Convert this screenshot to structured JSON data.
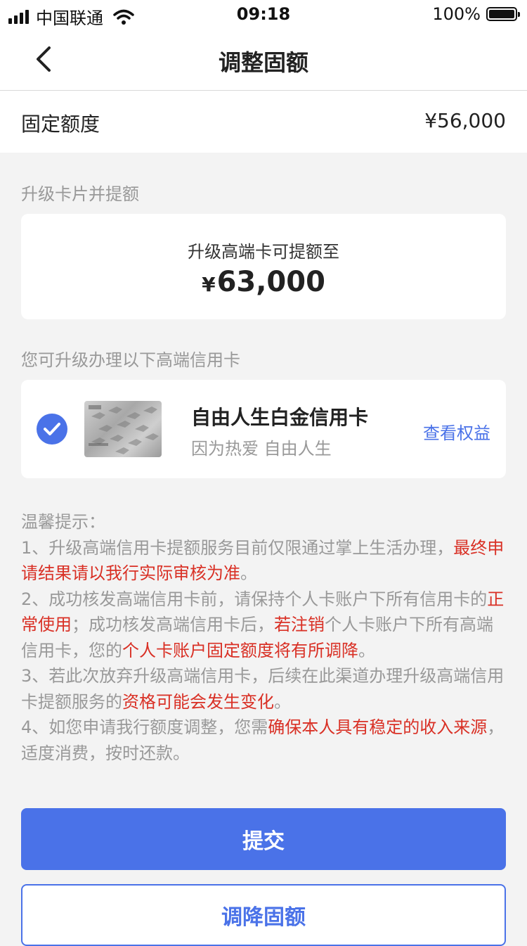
{
  "status_bar": {
    "carrier": "中国联通",
    "time": "09:18",
    "battery": "100%",
    "signal_icon": "signal-bars-icon",
    "wifi_icon": "wifi-icon",
    "battery_icon": "battery-icon"
  },
  "nav": {
    "title": "调整固额",
    "back_icon": "chevron-left-icon"
  },
  "fixed_limit": {
    "label": "固定额度",
    "value": "¥56,000"
  },
  "upgrade_section": {
    "label": "升级卡片并提额",
    "card_subtitle": "升级高端卡可提额至",
    "amount_symbol": "¥",
    "amount_value": "63,000"
  },
  "options_section": {
    "label": "您可升级办理以下高端信用卡",
    "card": {
      "name": "自由人生白金信用卡",
      "slogan": "因为热爱 自由人生",
      "link": "查看权益",
      "selected": true,
      "check_icon": "check-circle-icon"
    }
  },
  "tips": {
    "title": "温馨提示：",
    "item1": {
      "p1": "1、升级高端信用卡提额服务目前仅限通过掌上生活办理，",
      "r1": "最终申请结果请以我行实际审核为准",
      "p2": "。"
    },
    "item2": {
      "p1": "2、成功核发高端信用卡前，请保持个人卡账户下所有信用卡的",
      "r1": "正常使用",
      "p2": "；成功核发高端信用卡后，",
      "r2": "若注销",
      "p3": "个人卡账户下所有高端信用卡，您的",
      "r3": "个人卡账户固定额度将有所调降",
      "p4": "。"
    },
    "item3": {
      "p1": "3、若此次放弃升级高端信用卡，后续在此渠道办理升级高端信用卡提额服务的",
      "r1": "资格可能会发生变化",
      "p2": "。"
    },
    "item4": {
      "p1": "4、如您申请我行额度调整，您需",
      "r1": "确保本人具有稳定的收入来源",
      "p2": "，适度消费，按时还款。"
    }
  },
  "buttons": {
    "submit": "提交",
    "reduce": "调降固额"
  },
  "colors": {
    "accent": "#4a72e8",
    "warning": "#d93025",
    "background": "#f3f3f3"
  }
}
